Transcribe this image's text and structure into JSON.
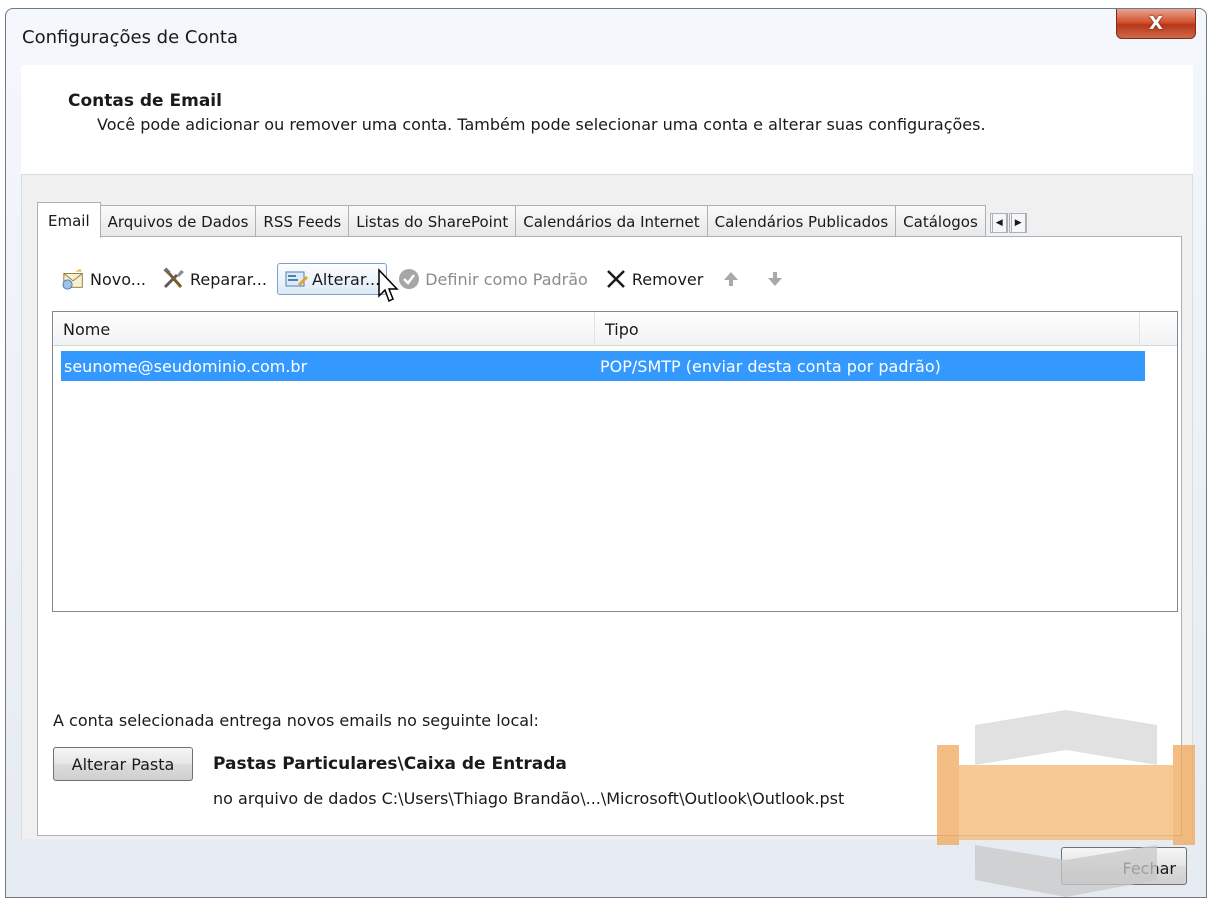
{
  "window": {
    "title": "Configurações de Conta",
    "close_glyph": "X"
  },
  "header": {
    "title": "Contas de Email",
    "description": "Você pode adicionar ou remover uma conta. Também pode selecionar uma conta e alterar suas configurações."
  },
  "tabs": [
    {
      "label": "Email",
      "active": true
    },
    {
      "label": "Arquivos de Dados"
    },
    {
      "label": "RSS Feeds"
    },
    {
      "label": "Listas do SharePoint"
    },
    {
      "label": "Calendários da Internet"
    },
    {
      "label": "Calendários Publicados"
    },
    {
      "label": "Catálogos"
    }
  ],
  "toolbar": {
    "new_label": "Novo...",
    "repair_label": "Reparar...",
    "change_label": "Alterar...",
    "set_default_label": "Definir como Padrão",
    "remove_label": "Remover"
  },
  "accounts": {
    "columns": {
      "name": "Nome",
      "type": "Tipo"
    },
    "rows": [
      {
        "name": "seunome@seudominio.com.br",
        "type": "POP/SMTP (enviar desta conta por padrão)",
        "selected": true
      }
    ]
  },
  "delivery": {
    "text": "A conta selecionada entrega novos emails no seguinte local:",
    "change_folder_label": "Alterar Pasta",
    "folder": "Pastas Particulares\\Caixa de Entrada",
    "path": "no arquivo de dados C:\\Users\\Thiago Brandão\\...\\Microsoft\\Outlook\\Outlook.pst"
  },
  "footer": {
    "close_label": "Fechar"
  },
  "colors": {
    "selection": "#3399ff",
    "close_button": "#c94a2c",
    "watermark_orange": "#f3b872"
  }
}
